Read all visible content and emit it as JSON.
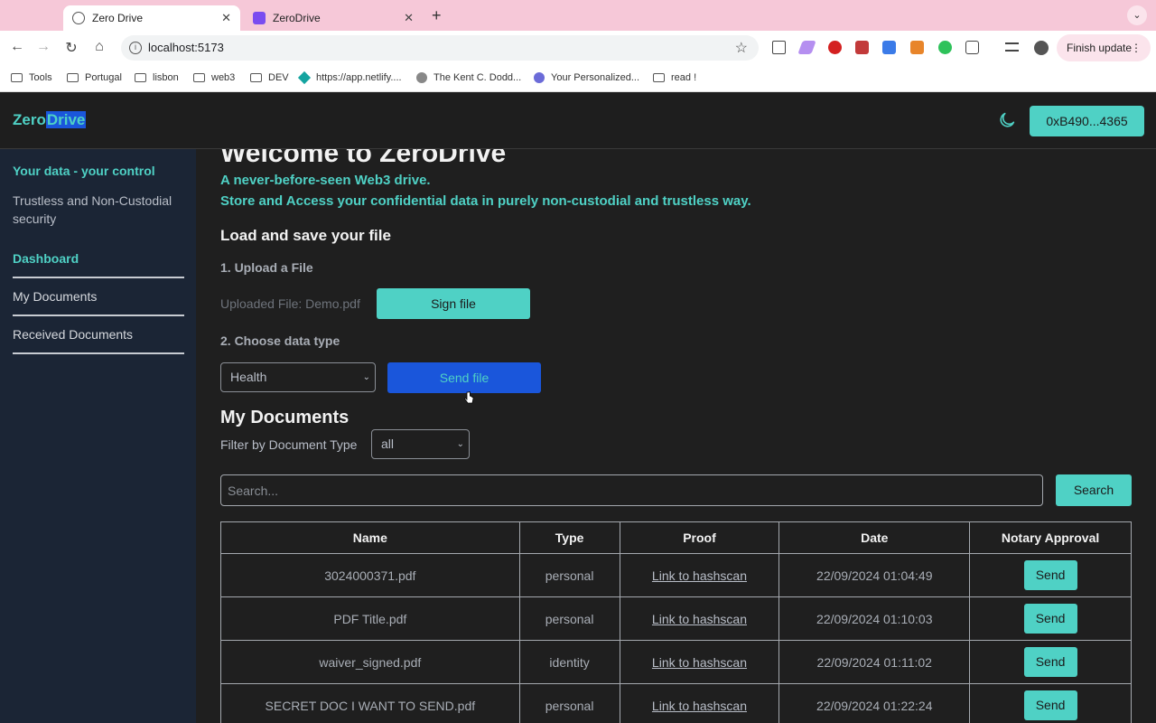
{
  "browser": {
    "tabs": [
      {
        "title": "Zero Drive",
        "active": true
      },
      {
        "title": "ZeroDrive",
        "active": false
      }
    ],
    "url": "localhost:5173",
    "finish_update_label": "Finish update",
    "bookmarks": [
      "Tools",
      "Portugal",
      "lisbon",
      "web3",
      "DEV",
      "https://app.netlify....",
      "The Kent C. Dodd...",
      "Your Personalized...",
      "read !"
    ]
  },
  "header": {
    "logo_part1": "Zero",
    "logo_part2": "Drive",
    "wallet_label": "0xB490...4365"
  },
  "sidebar": {
    "tagline": "Your data - your control",
    "subtitle": "Trustless and Non-Custodial security",
    "items": [
      {
        "label": "Dashboard",
        "active": true
      },
      {
        "label": "My Documents",
        "active": false
      },
      {
        "label": "Received Documents",
        "active": false
      }
    ]
  },
  "main": {
    "welcome_title": "Welcome to ZeroDrive",
    "tagline1": "A never-before-seen Web3 drive.",
    "tagline2": "Store and Access your confidential data in purely non-custodial and trustless way.",
    "load_section_title": "Load and save your file",
    "step1_label": "1. Upload a File",
    "uploaded_file_text": "Uploaded File: Demo.pdf",
    "sign_button_label": "Sign file",
    "step2_label": "2. Choose data type",
    "data_type_selected": "Health",
    "send_file_label": "Send file",
    "my_documents_title": "My Documents",
    "filter_label": "Filter by Document Type",
    "filter_selected": "all",
    "search_placeholder": "Search...",
    "search_button_label": "Search",
    "table": {
      "headers": [
        "Name",
        "Type",
        "Proof",
        "Date",
        "Notary Approval"
      ],
      "rows": [
        {
          "name": "3024000371.pdf",
          "type": "personal",
          "proof": "Link to hashscan",
          "date": "22/09/2024 01:04:49",
          "action": "Send"
        },
        {
          "name": "PDF Title.pdf",
          "type": "personal",
          "proof": "Link to hashscan",
          "date": "22/09/2024 01:10:03",
          "action": "Send"
        },
        {
          "name": "waiver_signed.pdf",
          "type": "identity",
          "proof": "Link to hashscan",
          "date": "22/09/2024 01:11:02",
          "action": "Send"
        },
        {
          "name": "SECRET DOC I WANT TO SEND.pdf",
          "type": "personal",
          "proof": "Link to hashscan",
          "date": "22/09/2024 01:22:24",
          "action": "Send"
        }
      ]
    }
  },
  "colors": {
    "accent": "#4fd1c5",
    "highlight_blue": "#1a56db",
    "sidebar_bg": "#1b2535",
    "main_bg": "#1f1f1f"
  }
}
